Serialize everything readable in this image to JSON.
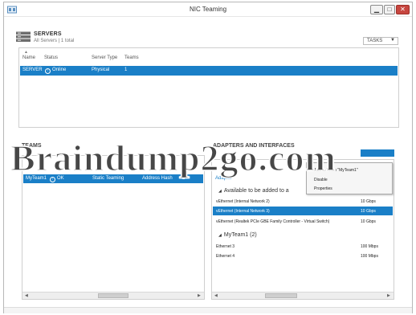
{
  "window": {
    "title": "NIC Teaming",
    "controls": {
      "minimize": "▁",
      "maximize": "□",
      "close": "✕"
    }
  },
  "servers": {
    "title": "SERVERS",
    "subtitle": "All Servers | 1 total",
    "tasks_label": "TASKS",
    "columns": [
      "Name",
      "Status",
      "Server Type",
      "Teams"
    ],
    "rows": [
      {
        "name": "SERVER",
        "status": "Online",
        "server_type": "Physical",
        "teams": "1"
      }
    ]
  },
  "teams": {
    "title": "TEAMS",
    "columns": [],
    "rows": [
      {
        "team": "MyTeam1",
        "status": "OK",
        "teaming_mode": "Static Teaming",
        "load_balancing": "Address Hash",
        "adapters": "2"
      }
    ]
  },
  "adapters": {
    "title": "ADAPTERS AND INTERFACES",
    "tasks_label": "",
    "column_header": "Adapter",
    "group_available": "Available to be added to a",
    "group_team": "MyTeam1 (2)",
    "available": [
      {
        "name": "vEthernet (Internal Network 2)",
        "speed": "10 Gbps",
        "selected": false
      },
      {
        "name": "vEthernet (Internal Network 3)",
        "speed": "10 Gbps",
        "selected": true
      },
      {
        "name": "vEthernet (Realtek PCIe GBE Family Controller - Virtual Switch)",
        "speed": "10 Gbps",
        "selected": false
      }
    ],
    "team_members": [
      {
        "name": "Ethernet 3",
        "speed": "100 Mbps"
      },
      {
        "name": "Ethernet 4",
        "speed": "100 Mbps"
      }
    ]
  },
  "context_menu": {
    "items": [
      "Add to Team \"MyTeam1\"",
      "Disable",
      "Properties"
    ]
  },
  "watermark": "Braindump2go.com",
  "colors": {
    "selection": "#1a7fc7",
    "close_button": "#c7463f"
  },
  "icons": {
    "servers": "server-stack-icon",
    "status_ok": "status-ok-icon",
    "app": "nic-teaming-app-icon"
  }
}
